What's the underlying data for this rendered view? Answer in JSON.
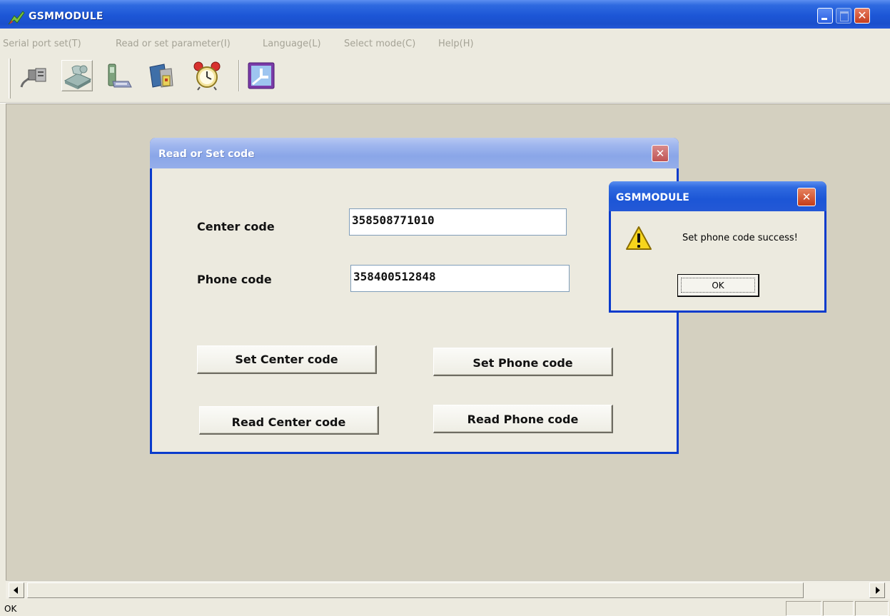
{
  "window": {
    "title": "GSMMODULE",
    "controls": {
      "close_glyph": "✕"
    }
  },
  "menu": [
    {
      "label": "Serial port set(T)"
    },
    {
      "label": "Read or set parameter(I)"
    },
    {
      "label": "Language(L)"
    },
    {
      "label": "Select mode(C)"
    },
    {
      "label": "Help(H)"
    }
  ],
  "toolbar": {
    "buttons": [
      {
        "icon": "serial-port-icon"
      },
      {
        "icon": "module-settings-icon",
        "pressed": true
      },
      {
        "icon": "phone-icon"
      },
      {
        "icon": "document-folder-icon"
      },
      {
        "icon": "alarm-clock-icon"
      },
      {
        "icon": "clock-icon"
      }
    ]
  },
  "dialog": {
    "title": "Read or Set code",
    "close_glyph": "✕",
    "center_label": "Center code",
    "center_value": "358508771010",
    "phone_label": "Phone code",
    "phone_value": "358400512848",
    "set_center_button": "Set Center code",
    "set_phone_button": "Set Phone code",
    "read_center_button": "Read Center code",
    "read_phone_button": "Read Phone code"
  },
  "message_box": {
    "title": "GSMMODULE",
    "close_glyph": "✕",
    "message": "Set phone code success!",
    "ok_button": "OK",
    "icon": "warning-icon"
  },
  "status_bar": {
    "text": "OK"
  },
  "colors": {
    "titlebar_blue": "#1c56d6",
    "client_background": "#d4d0c0",
    "dialog_background": "#eceadf",
    "close_red": "#c53d1e"
  }
}
